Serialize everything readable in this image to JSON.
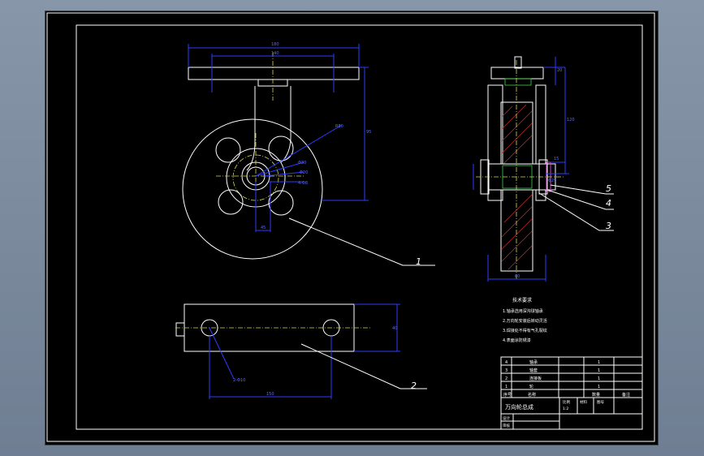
{
  "drawing": {
    "part_callouts": [
      "1",
      "2",
      "3",
      "4",
      "5"
    ],
    "notes": {
      "heading": "技术要求",
      "lines": [
        "1.轴承选用深沟球轴承",
        "2.万向轮安装后转动灵活",
        "3.焊接处不得有气孔裂纹",
        "4.表面涂防锈漆"
      ]
    },
    "title_block": {
      "title": "万向轮总成",
      "rows": [
        {
          "no": "4",
          "name": "轴承",
          "qty": "1"
        },
        {
          "no": "3",
          "name": "轴套",
          "qty": "1"
        },
        {
          "no": "2",
          "name": "连接板",
          "qty": "1"
        },
        {
          "no": "1",
          "name": "轮",
          "qty": "1"
        }
      ],
      "header": {
        "no": "序号",
        "name": "名称",
        "qty": "数量",
        "remark": "备注"
      },
      "scale_label": "比例",
      "scale_value": "1:2",
      "sheet_label": "图号",
      "material_label": "材料",
      "designer_label": "设计",
      "checker_label": "审核"
    },
    "dimension_labels": {
      "top_width": "180",
      "top_inner": "140",
      "height": "95",
      "radius": "R80",
      "bore": "Φ30",
      "bore2": "Φ20",
      "hole": "4-Φ8",
      "center": "45",
      "plate_len": "150",
      "plate_h": "40",
      "plate_hole": "2-Φ10",
      "side_total": "120",
      "side_upper": "20",
      "side_w": "60",
      "side_small": "15",
      "side_d": "Φ25"
    }
  }
}
